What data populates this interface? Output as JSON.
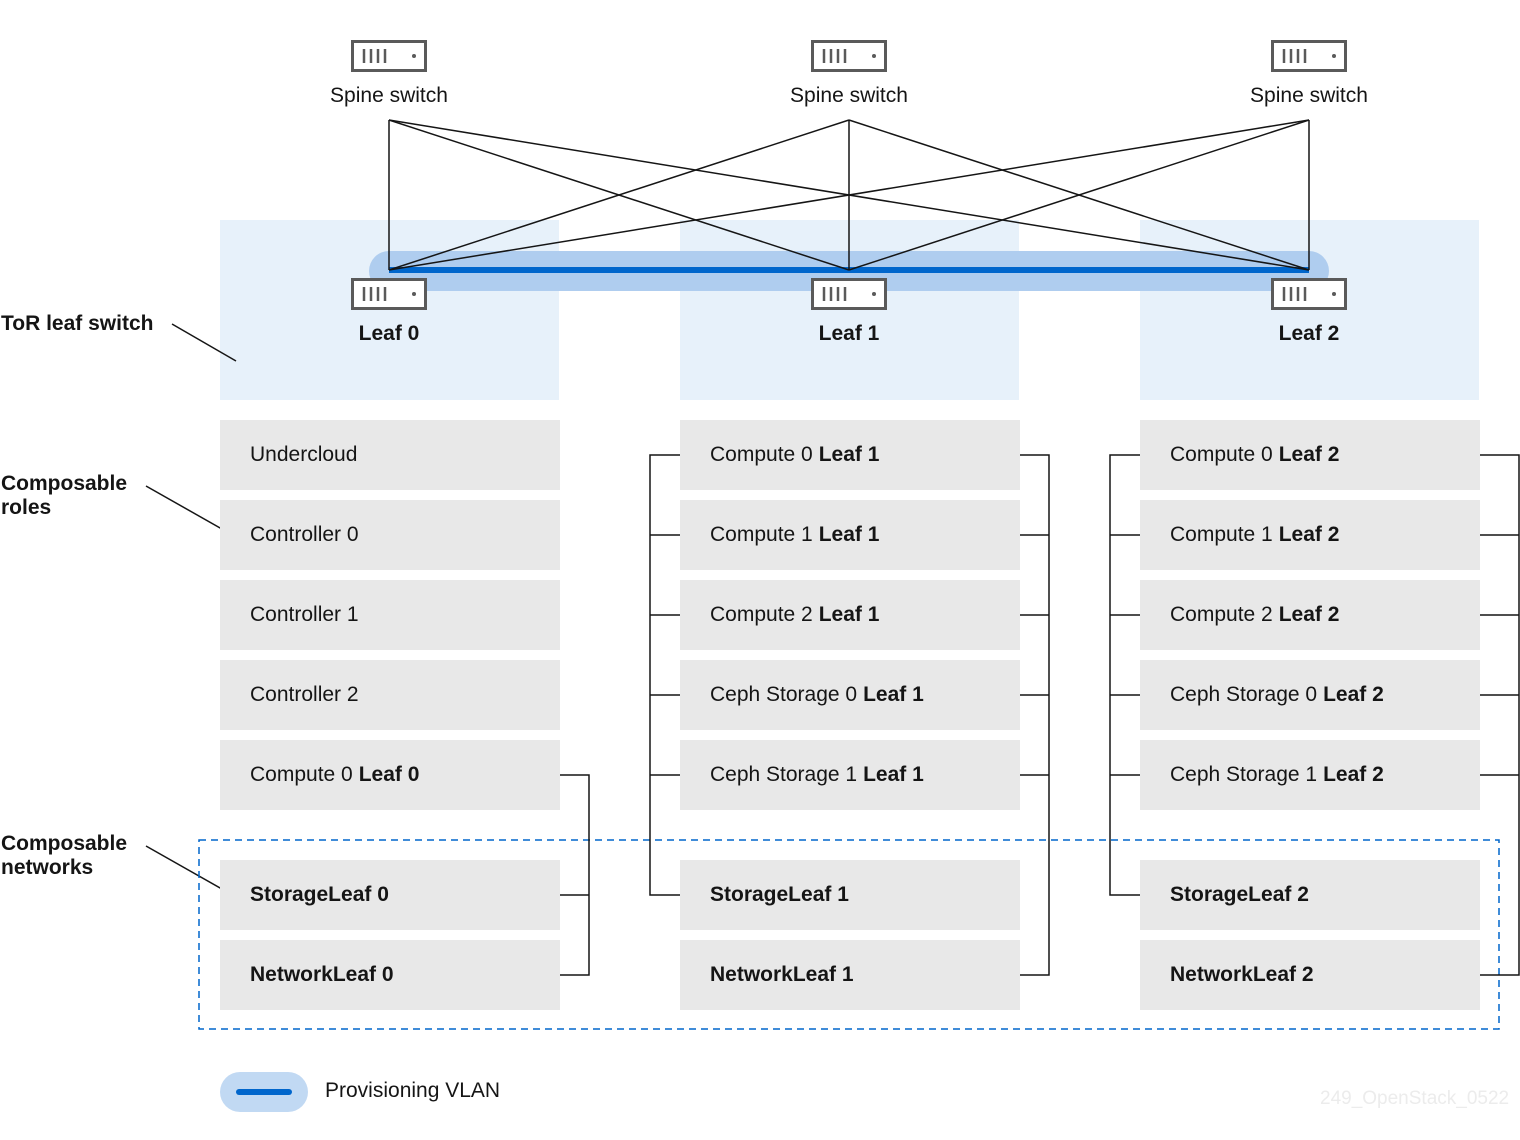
{
  "diagram": {
    "spines": [
      {
        "label": "Spine switch",
        "icon": "switch-icon"
      },
      {
        "label": "Spine switch",
        "icon": "switch-icon"
      },
      {
        "label": "Spine switch",
        "icon": "switch-icon"
      }
    ],
    "leaves": [
      {
        "label": "Leaf 0",
        "icon": "switch-icon"
      },
      {
        "label": "Leaf 1",
        "icon": "switch-icon"
      },
      {
        "label": "Leaf 2",
        "icon": "switch-icon"
      }
    ],
    "side_labels": {
      "tor": "ToR leaf switch",
      "roles_line1": "Composable",
      "roles_line2": "roles",
      "networks_line1": "Composable",
      "networks_line2": "networks"
    },
    "columns": [
      {
        "roles": [
          {
            "text": "Undercloud",
            "bold": ""
          },
          {
            "text": "Controller 0",
            "bold": ""
          },
          {
            "text": "Controller 1",
            "bold": ""
          },
          {
            "text": "Controller 2",
            "bold": ""
          },
          {
            "text": "Compute 0",
            "bold": "Leaf 0"
          }
        ],
        "networks": [
          "StorageLeaf 0",
          "NetworkLeaf 0"
        ]
      },
      {
        "roles": [
          {
            "text": "Compute 0",
            "bold": "Leaf 1"
          },
          {
            "text": "Compute 1",
            "bold": "Leaf 1"
          },
          {
            "text": "Compute 2",
            "bold": "Leaf 1"
          },
          {
            "text": "Ceph Storage 0",
            "bold": "Leaf 1"
          },
          {
            "text": "Ceph Storage 1",
            "bold": "Leaf 1"
          }
        ],
        "networks": [
          "StorageLeaf 1",
          "NetworkLeaf 1"
        ]
      },
      {
        "roles": [
          {
            "text": "Compute 0",
            "bold": "Leaf 2"
          },
          {
            "text": "Compute 1",
            "bold": "Leaf 2"
          },
          {
            "text": "Compute 2",
            "bold": "Leaf 2"
          },
          {
            "text": "Ceph Storage 0",
            "bold": "Leaf 2"
          },
          {
            "text": "Ceph Storage 1",
            "bold": "Leaf 2"
          }
        ],
        "networks": [
          "StorageLeaf 2",
          "NetworkLeaf 2"
        ]
      }
    ],
    "legend": {
      "label": "Provisioning VLAN"
    },
    "watermark": "249_OpenStack_0522",
    "colors": {
      "tor_zone": "#e7f1fa",
      "vlan_band": "#afcdef",
      "vlan_line": "#0066cc",
      "role_box": "#e8e8e8",
      "network_border": "#0066cc"
    }
  }
}
